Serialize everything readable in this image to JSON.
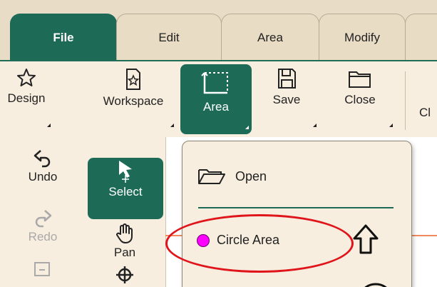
{
  "tabs": [
    {
      "label": "File",
      "active": true
    },
    {
      "label": "Edit",
      "active": false
    },
    {
      "label": "Area",
      "active": false
    },
    {
      "label": "Modify",
      "active": false
    }
  ],
  "ribbon": {
    "design": "Design",
    "workspace": "Workspace",
    "area": "Area",
    "save": "Save",
    "close": "Close",
    "cut_off": "Cl"
  },
  "tools": {
    "undo": "Undo",
    "select": "Select",
    "redo": "Redo",
    "pan": "Pan"
  },
  "menu": {
    "open": "Open",
    "circle_area": "Circle Area"
  },
  "colors": {
    "accent": "#1d6b57",
    "circle_dot": "#ff00ff",
    "highlight": "#e0141b",
    "guide_line": "#f08a5d"
  }
}
